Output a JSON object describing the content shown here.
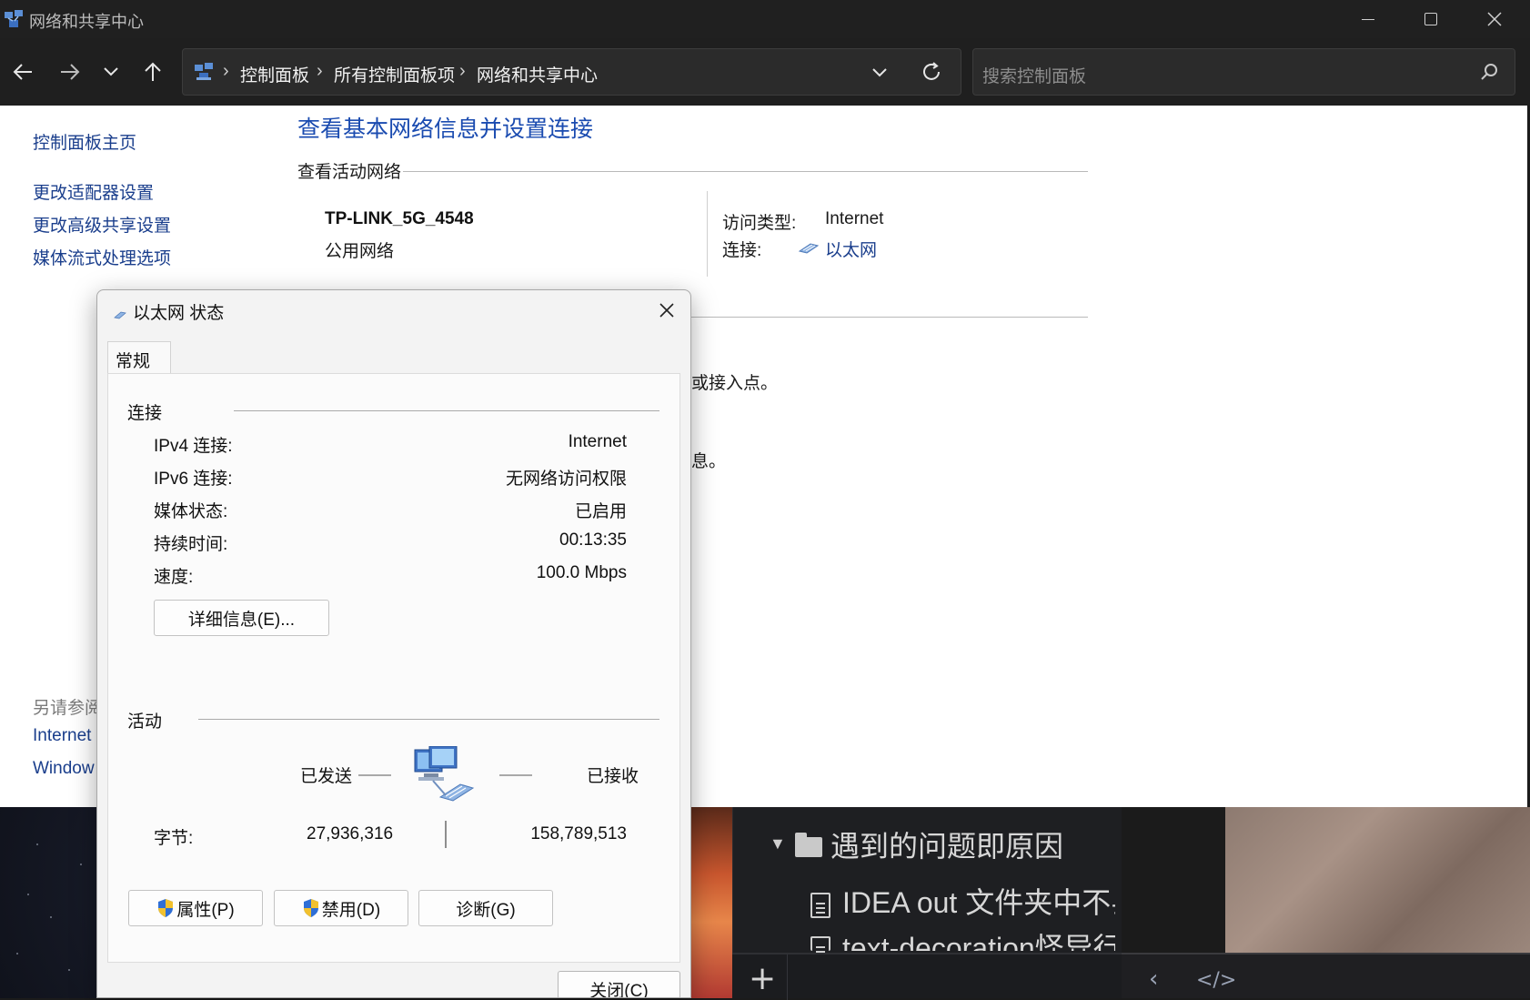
{
  "window": {
    "title": "网络和共享中心",
    "controls": {
      "minimize": "minimize",
      "maximize": "maximize",
      "close": "close"
    }
  },
  "navbar": {
    "breadcrumbs": [
      "控制面板",
      "所有控制面板项",
      "网络和共享中心"
    ],
    "search_placeholder": "搜索控制面板"
  },
  "sidebar": {
    "home": "控制面板主页",
    "links": [
      "更改适配器设置",
      "更改高级共享设置",
      "媒体流式处理选项"
    ],
    "see_also_heading": "另请参阅",
    "see_also_links": [
      "Internet",
      "Window"
    ]
  },
  "main": {
    "title": "查看基本网络信息并设置连接",
    "active_networks_heading": "查看活动网络",
    "network": {
      "name": "TP-LINK_5G_4548",
      "category": "公用网络",
      "access_type_label": "访问类型:",
      "access_type_value": "Internet",
      "connections_label": "连接:",
      "connection_link": "以太网"
    },
    "partially_hidden_text": [
      "或接入点。",
      "息。"
    ]
  },
  "dialog": {
    "title": "以太网 状态",
    "tab": "常规",
    "connection_heading": "连接",
    "rows": [
      {
        "label": "IPv4 连接:",
        "value": "Internet"
      },
      {
        "label": "IPv6 连接:",
        "value": "无网络访问权限"
      },
      {
        "label": "媒体状态:",
        "value": "已启用"
      },
      {
        "label": "持续时间:",
        "value": "00:13:35"
      },
      {
        "label": "速度:",
        "value": "100.0 Mbps"
      }
    ],
    "details_button": "详细信息(E)...",
    "activity_heading": "活动",
    "sent_label": "已发送",
    "received_label": "已接收",
    "bytes_label": "字节:",
    "bytes_sent": "27,936,316",
    "bytes_received": "158,789,513",
    "buttons": {
      "properties": "属性(P)",
      "disable": "禁用(D)",
      "diagnose": "诊断(G)"
    },
    "close_button": "关闭(C)"
  },
  "background_editor": {
    "folder_item": "遇到的问题即原因",
    "file_items": [
      "IDEA out 文件夹中不县",
      "text-decoration怪异行"
    ]
  },
  "colors": {
    "titlebar_bg": "#202020",
    "navbar_bg": "#1f1f1f",
    "link": "#1a3e8c",
    "page_title": "#1a4bb0",
    "dialog_bg": "#f3f3f3"
  },
  "icons": [
    "app-network-icon",
    "back-arrow-icon",
    "forward-arrow-icon",
    "recent-chevron-icon",
    "up-arrow-icon",
    "control-panel-icon",
    "chevron-down-icon",
    "refresh-icon",
    "search-icon",
    "ethernet-icon",
    "close-icon",
    "shield-icon",
    "network-computers-icon",
    "folder-icon",
    "file-icon",
    "plus-icon",
    "chevron-left-icon",
    "code-icon"
  ]
}
